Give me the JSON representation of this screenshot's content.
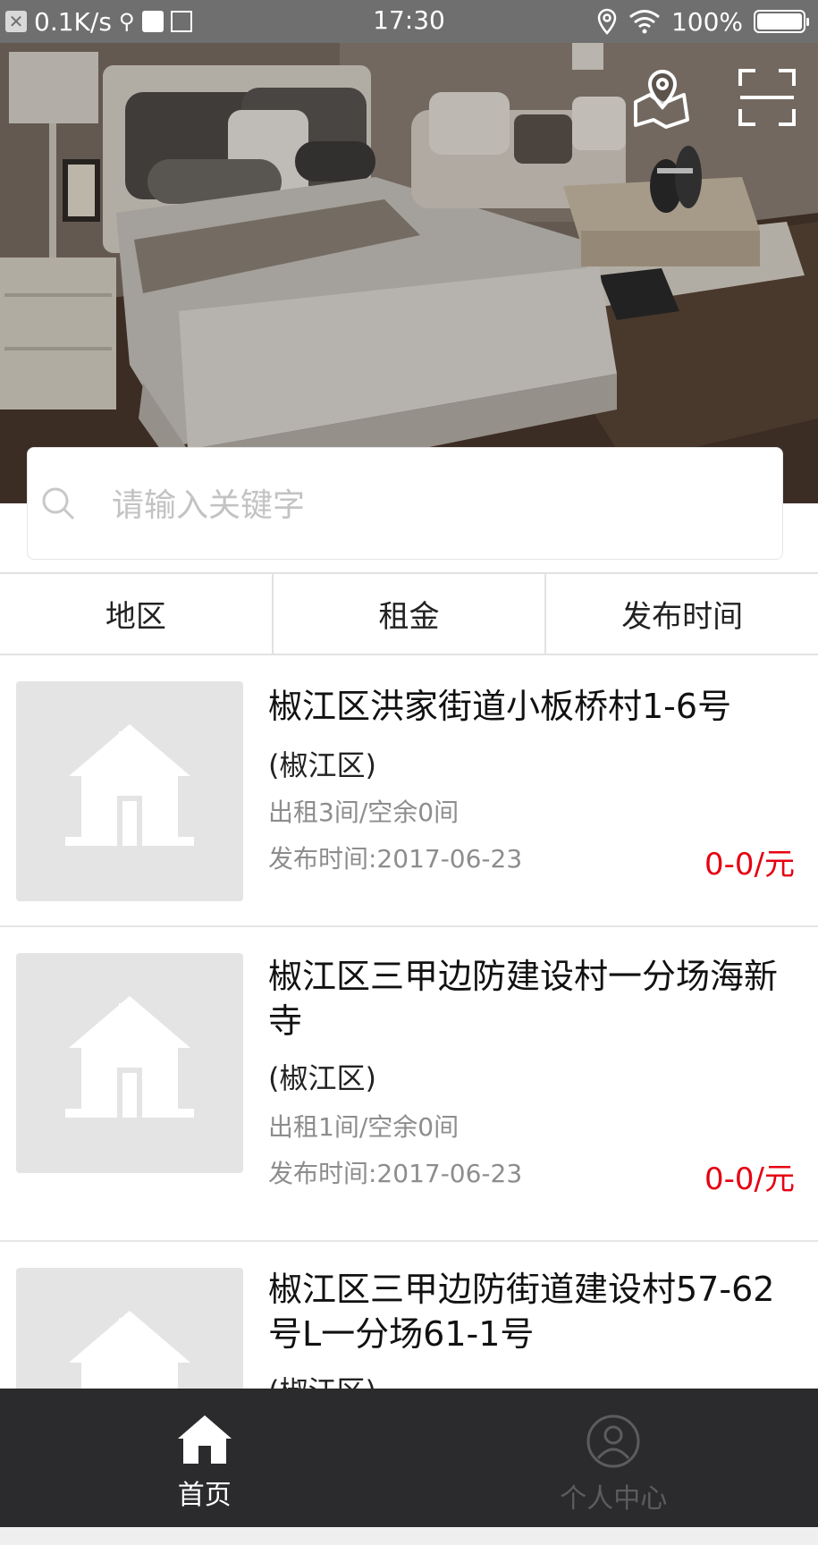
{
  "status_bar": {
    "speed": "0.1K/s",
    "time": "17:30",
    "battery": "100%",
    "battery_level": 1.0
  },
  "hero": {
    "map_icon": "map-location-icon",
    "scan_icon": "scan-icon"
  },
  "search": {
    "placeholder": "请输入关键字"
  },
  "filters": [
    {
      "label": "地区"
    },
    {
      "label": "租金"
    },
    {
      "label": "发布时间"
    }
  ],
  "listings": [
    {
      "title": "椒江区洪家街道小板桥村1-6号",
      "district": "(椒江区)",
      "rooms": "出租3间/空余0间",
      "date": "发布时间:2017-06-23",
      "price": "0-0/元"
    },
    {
      "title": "椒江区三甲边防建设村一分场海新寺",
      "district": "(椒江区)",
      "rooms": "出租1间/空余0间",
      "date": "发布时间:2017-06-23",
      "price": "0-0/元"
    },
    {
      "title": "椒江区三甲边防街道建设村57-62号L一分场61-1号",
      "district": "(椒江区)",
      "rooms": "",
      "date": "",
      "price": ""
    }
  ],
  "tabbar": {
    "home": {
      "label": "首页",
      "icon": "home-icon"
    },
    "profile": {
      "label": "个人中心",
      "icon": "user-icon"
    }
  },
  "colors": {
    "price": "#e60012",
    "tabbar_bg": "#2b2b2d",
    "status_bar_bg": "#6f6f6f"
  }
}
